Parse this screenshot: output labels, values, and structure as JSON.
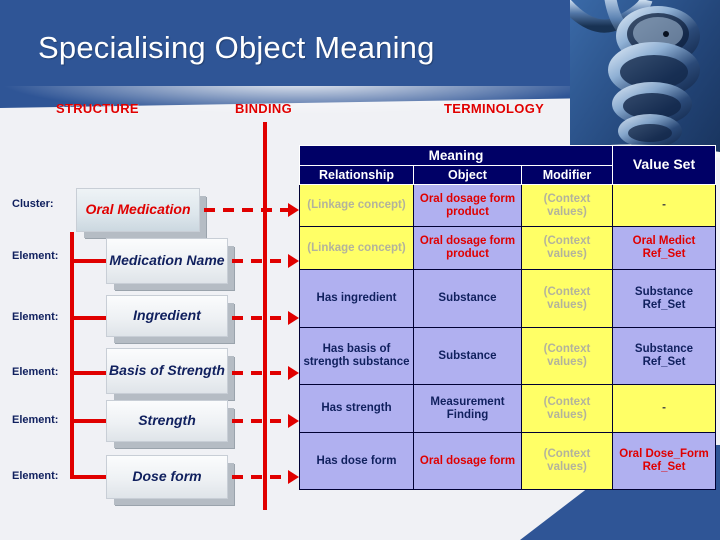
{
  "slide": {
    "title": "Specialising Object Meaning",
    "accent_red": "#e00000",
    "banner_blue": "#2f5596",
    "navy": "#000066",
    "yellow": "#ffff66",
    "purple": "#b0b0f0",
    "background": "#f0f1f5"
  },
  "captions": {
    "structure": "STRUCTURE",
    "binding": "BINDING",
    "terminology": "TERMINOLOGY"
  },
  "structure": {
    "rows": [
      {
        "label": "Cluster:",
        "box": "Oral Medication",
        "kind": "cluster"
      },
      {
        "label": "Element:",
        "box": "Medication Name",
        "kind": "element"
      },
      {
        "label": "Element:",
        "box": "Ingredient",
        "kind": "element"
      },
      {
        "label": "Element:",
        "box": "Basis of Strength",
        "kind": "element"
      },
      {
        "label": "Element:",
        "box": "Strength",
        "kind": "element"
      },
      {
        "label": "Element:",
        "box": "Dose form",
        "kind": "element"
      }
    ]
  },
  "table": {
    "group_header": "Meaning",
    "value_set_header": "Value Set",
    "columns": [
      "Relationship",
      "Object",
      "Modifier",
      "Value Set"
    ],
    "rows": [
      {
        "relationship": {
          "text": "(Linkage concept)",
          "fill": "yellow",
          "tone": "grey"
        },
        "object": {
          "text": "Oral dosage form product",
          "fill": "purple",
          "tone": "red"
        },
        "modifier": {
          "text": "(Context values)",
          "fill": "yellow",
          "tone": "grey"
        },
        "value_set": {
          "text": "-",
          "fill": "yellow",
          "tone": "dash"
        }
      },
      {
        "relationship": {
          "text": "(Linkage concept)",
          "fill": "yellow",
          "tone": "grey"
        },
        "object": {
          "text": "Oral dosage form product",
          "fill": "purple",
          "tone": "red"
        },
        "modifier": {
          "text": "(Context values)",
          "fill": "yellow",
          "tone": "grey"
        },
        "value_set": {
          "text": "Oral Medict Ref_Set",
          "fill": "purple",
          "tone": "red"
        }
      },
      {
        "relationship": {
          "text": "Has ingredient",
          "fill": "purple",
          "tone": "navy"
        },
        "object": {
          "text": "Substance",
          "fill": "purple",
          "tone": "navy"
        },
        "modifier": {
          "text": "(Context values)",
          "fill": "yellow",
          "tone": "grey"
        },
        "value_set": {
          "text": "Substance Ref_Set",
          "fill": "purple",
          "tone": "navy"
        }
      },
      {
        "relationship": {
          "text": "Has basis of strength substance",
          "fill": "purple",
          "tone": "navy"
        },
        "object": {
          "text": "Substance",
          "fill": "purple",
          "tone": "navy"
        },
        "modifier": {
          "text": "(Context values)",
          "fill": "yellow",
          "tone": "grey"
        },
        "value_set": {
          "text": "Substance Ref_Set",
          "fill": "purple",
          "tone": "navy"
        }
      },
      {
        "relationship": {
          "text": "Has strength",
          "fill": "purple",
          "tone": "navy"
        },
        "object": {
          "text": "Measurement Finding",
          "fill": "purple",
          "tone": "navy"
        },
        "modifier": {
          "text": "(Context values)",
          "fill": "yellow",
          "tone": "grey"
        },
        "value_set": {
          "text": "-",
          "fill": "yellow",
          "tone": "dash"
        }
      },
      {
        "relationship": {
          "text": "Has dose form",
          "fill": "purple",
          "tone": "navy"
        },
        "object": {
          "text": "Oral dosage form",
          "fill": "purple",
          "tone": "red"
        },
        "modifier": {
          "text": "(Context values)",
          "fill": "yellow",
          "tone": "grey"
        },
        "value_set": {
          "text": "Oral Dose_Form Ref_Set",
          "fill": "purple",
          "tone": "red"
        }
      }
    ]
  }
}
